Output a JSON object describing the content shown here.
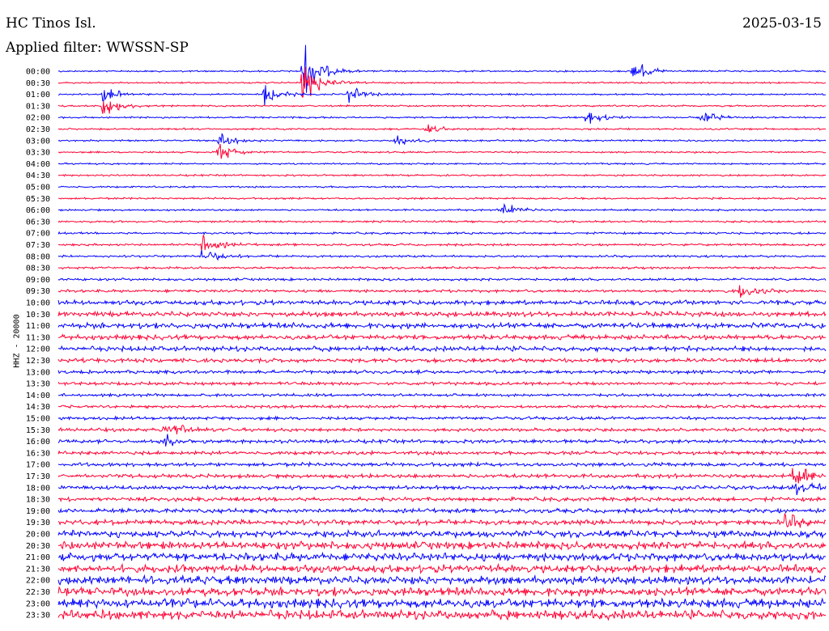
{
  "header": {
    "station": "HC Tinos Isl.",
    "date": "2025-03-15",
    "filter": "Applied filter: WWSSN-SP"
  },
  "chart_data": {
    "type": "line",
    "title": "HC Tinos Isl.",
    "date": "2025-03-15",
    "filter": "Applied filter: WWSSN-SP",
    "ylabel": "HHZ - 20000",
    "row_labels": [
      "00:00",
      "00:30",
      "01:00",
      "01:30",
      "02:00",
      "02:30",
      "03:00",
      "03:30",
      "04:00",
      "04:30",
      "05:00",
      "05:30",
      "06:00",
      "06:30",
      "07:00",
      "07:30",
      "08:00",
      "08:30",
      "09:00",
      "09:30",
      "10:00",
      "10:30",
      "11:00",
      "11:30",
      "12:00",
      "12:30",
      "13:00",
      "13:30",
      "14:00",
      "14:30",
      "15:00",
      "15:30",
      "16:00",
      "16:30",
      "17:00",
      "17:30",
      "18:00",
      "18:30",
      "19:00",
      "19:30",
      "20:00",
      "20:30",
      "21:00",
      "21:30",
      "22:00",
      "22:30",
      "23:00",
      "23:30"
    ],
    "series_colors": [
      "#0000ff",
      "#ff0033"
    ],
    "color_order": "alternating per row, starting blue",
    "noise_level": [
      0.12,
      0.12,
      0.12,
      0.13,
      0.13,
      0.13,
      0.13,
      0.13,
      0.13,
      0.13,
      0.13,
      0.14,
      0.14,
      0.15,
      0.16,
      0.17,
      0.17,
      0.18,
      0.19,
      0.21,
      0.35,
      0.38,
      0.42,
      0.36,
      0.38,
      0.3,
      0.26,
      0.24,
      0.22,
      0.22,
      0.24,
      0.26,
      0.27,
      0.27,
      0.29,
      0.3,
      0.3,
      0.31,
      0.33,
      0.4,
      0.52,
      0.58,
      0.6,
      0.6,
      0.62,
      0.64,
      0.68,
      0.7
    ],
    "events": [
      {
        "row": 0,
        "t": 0.32,
        "amp": 4.5
      },
      {
        "row": 1,
        "t": 0.32,
        "amp": 3.5
      },
      {
        "row": 2,
        "t": 0.27,
        "amp": 1.6
      },
      {
        "row": 2,
        "t": 0.38,
        "amp": 1.2
      },
      {
        "row": 2,
        "t": 0.06,
        "amp": 1.2
      },
      {
        "row": 0,
        "t": 0.75,
        "amp": 1.8
      },
      {
        "row": 3,
        "t": 0.06,
        "amp": 1.6
      },
      {
        "row": 4,
        "t": 0.69,
        "amp": 1.0
      },
      {
        "row": 4,
        "t": 0.84,
        "amp": 1.0
      },
      {
        "row": 5,
        "t": 0.48,
        "amp": 0.9
      },
      {
        "row": 6,
        "t": 0.44,
        "amp": 1.0
      },
      {
        "row": 6,
        "t": 0.21,
        "amp": 1.4
      },
      {
        "row": 7,
        "t": 0.21,
        "amp": 1.6
      },
      {
        "row": 12,
        "t": 0.58,
        "amp": 1.2
      },
      {
        "row": 15,
        "t": 0.19,
        "amp": 1.5
      },
      {
        "row": 16,
        "t": 0.19,
        "amp": 1.3
      },
      {
        "row": 19,
        "t": 0.89,
        "amp": 1.3
      },
      {
        "row": 31,
        "t": 0.14,
        "amp": 1.6
      },
      {
        "row": 32,
        "t": 0.14,
        "amp": 1.2
      },
      {
        "row": 35,
        "t": 0.96,
        "amp": 1.8
      },
      {
        "row": 36,
        "t": 0.96,
        "amp": 1.6
      },
      {
        "row": 39,
        "t": 0.95,
        "amp": 1.2
      }
    ]
  }
}
